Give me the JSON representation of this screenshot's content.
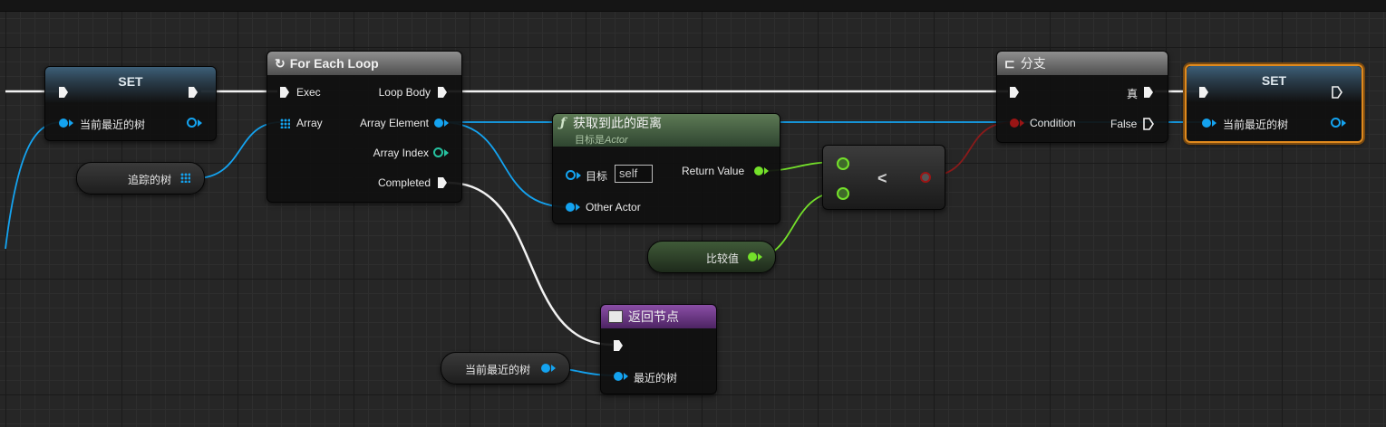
{
  "nodes": {
    "set_left": {
      "title": "SET",
      "var_label": "当前最近的树"
    },
    "for_each": {
      "title": "For Each Loop",
      "exec_in": "Exec",
      "array_in": "Array",
      "loop_body": "Loop Body",
      "array_element": "Array Element",
      "array_index": "Array Index",
      "completed": "Completed"
    },
    "tracked_var": {
      "label": "追踪的树"
    },
    "distance": {
      "title": "获取到此的距离",
      "subtitle_prefix": "目标是",
      "subtitle_class": "Actor",
      "target_label": "目标",
      "target_value": "self",
      "return_value": "Return Value",
      "other_actor": "Other Actor"
    },
    "less": {
      "op": "<"
    },
    "compare_var": {
      "label": "比较值"
    },
    "branch": {
      "title": "分支",
      "true_label": "真",
      "condition": "Condition",
      "false_label": "False"
    },
    "set_right": {
      "title": "SET",
      "var_label": "当前最近的树"
    },
    "return_node": {
      "title": "返回节点",
      "output_label": "最近的树"
    },
    "nearest_var": {
      "label": "当前最近的树"
    }
  },
  "colors": {
    "exec": "#f2f2f2",
    "object_pin": "#14a3f0",
    "int_pin": "#26c2a0",
    "float_pin": "#74e12a",
    "bool_pin": "#9a1515",
    "selection": "#e08a1e"
  },
  "icons": [
    "loop-icon",
    "function-icon",
    "branch-icon",
    "return-node-icon",
    "array-grid-icon"
  ]
}
